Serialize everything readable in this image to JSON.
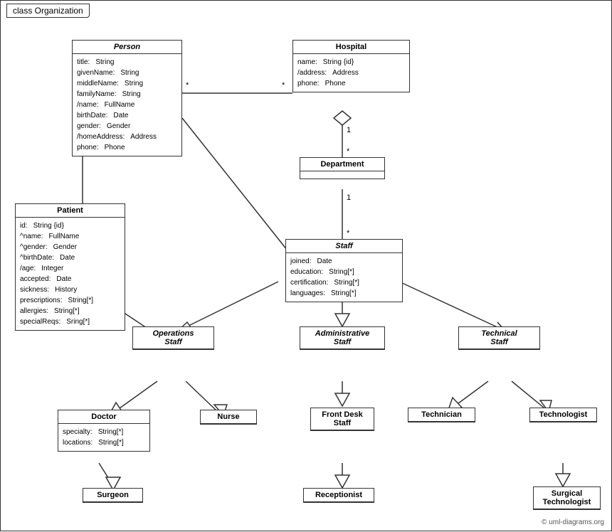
{
  "title": "class Organization",
  "copyright": "© uml-diagrams.org",
  "classes": {
    "person": {
      "name": "Person",
      "italic": true,
      "attrs": [
        [
          "title:",
          "String"
        ],
        [
          "givenName:",
          "String"
        ],
        [
          "middleName:",
          "String"
        ],
        [
          "familyName:",
          "String"
        ],
        [
          "/name:",
          "FullName"
        ],
        [
          "birthDate:",
          "Date"
        ],
        [
          "gender:",
          "Gender"
        ],
        [
          "/homeAddress:",
          "Address"
        ],
        [
          "phone:",
          "Phone"
        ]
      ]
    },
    "hospital": {
      "name": "Hospital",
      "italic": false,
      "attrs": [
        [
          "name:",
          "String {id}"
        ],
        [
          "/address:",
          "Address"
        ],
        [
          "phone:",
          "Phone"
        ]
      ]
    },
    "patient": {
      "name": "Patient",
      "italic": false,
      "attrs": [
        [
          "id:",
          "String {id}"
        ],
        [
          "^name:",
          "FullName"
        ],
        [
          "^gender:",
          "Gender"
        ],
        [
          "^birthDate:",
          "Date"
        ],
        [
          "/age:",
          "Integer"
        ],
        [
          "accepted:",
          "Date"
        ],
        [
          "sickness:",
          "History"
        ],
        [
          "prescriptions:",
          "String[*]"
        ],
        [
          "allergies:",
          "String[*]"
        ],
        [
          "specialReqs:",
          "Sring[*]"
        ]
      ]
    },
    "department": {
      "name": "Department",
      "italic": false,
      "attrs": []
    },
    "staff": {
      "name": "Staff",
      "italic": true,
      "attrs": [
        [
          "joined:",
          "Date"
        ],
        [
          "education:",
          "String[*]"
        ],
        [
          "certification:",
          "String[*]"
        ],
        [
          "languages:",
          "String[*]"
        ]
      ]
    },
    "operationsStaff": {
      "name": "Operations\nStaff",
      "italic": true,
      "attrs": []
    },
    "administrativeStaff": {
      "name": "Administrative\nStaff",
      "italic": true,
      "attrs": []
    },
    "technicalStaff": {
      "name": "Technical\nStaff",
      "italic": true,
      "attrs": []
    },
    "doctor": {
      "name": "Doctor",
      "italic": false,
      "attrs": [
        [
          "specialty:",
          "String[*]"
        ],
        [
          "locations:",
          "String[*]"
        ]
      ]
    },
    "nurse": {
      "name": "Nurse",
      "italic": false,
      "attrs": []
    },
    "frontDeskStaff": {
      "name": "Front Desk\nStaff",
      "italic": false,
      "attrs": []
    },
    "technician": {
      "name": "Technician",
      "italic": false,
      "attrs": []
    },
    "technologist": {
      "name": "Technologist",
      "italic": false,
      "attrs": []
    },
    "surgeon": {
      "name": "Surgeon",
      "italic": false,
      "attrs": []
    },
    "receptionist": {
      "name": "Receptionist",
      "italic": false,
      "attrs": []
    },
    "surgicalTechnologist": {
      "name": "Surgical\nTechnologist",
      "italic": false,
      "attrs": []
    }
  }
}
